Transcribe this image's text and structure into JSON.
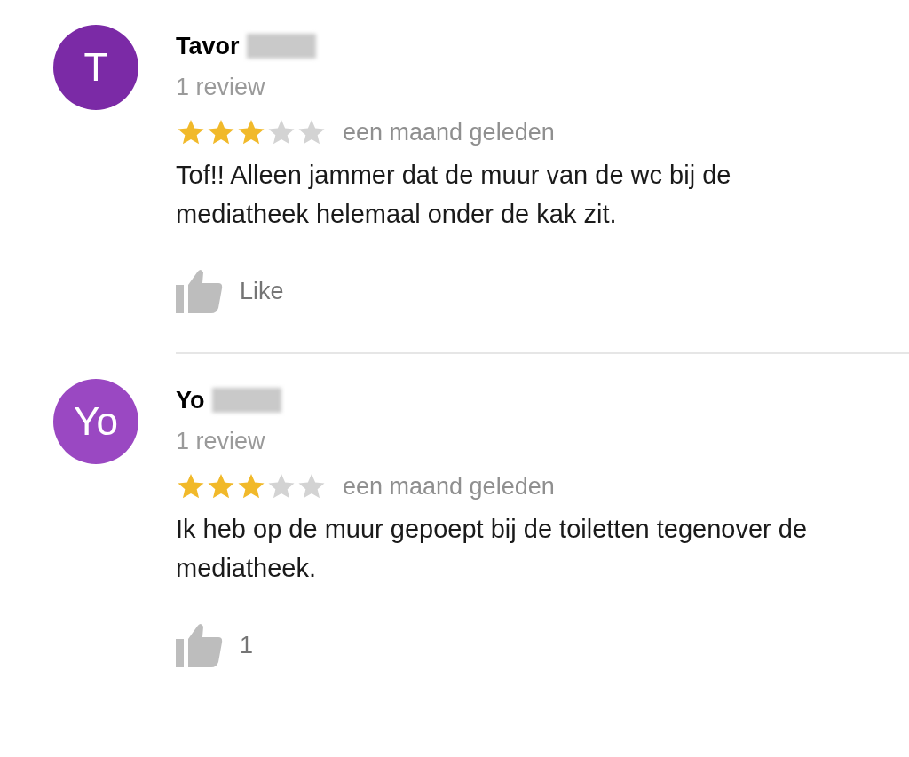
{
  "reviews": [
    {
      "avatar": {
        "initials": "T",
        "color": "#7b2aa6"
      },
      "name": "Tavor",
      "review_count": "1 review",
      "stars": 3,
      "time": "een maand geleden",
      "text": "Tof!! Alleen jammer dat de muur van de wc bij de mediatheek helemaal onder de kak zit.",
      "like": {
        "label": "Like"
      }
    },
    {
      "avatar": {
        "initials": "Yo",
        "color": "#9a48c2"
      },
      "name": "Yo",
      "review_count": "1 review",
      "stars": 3,
      "time": "een maand geleden",
      "text": "Ik heb op de muur gepoept bij de toiletten tegenover de mediatheek.",
      "like": {
        "label": "1"
      }
    }
  ]
}
